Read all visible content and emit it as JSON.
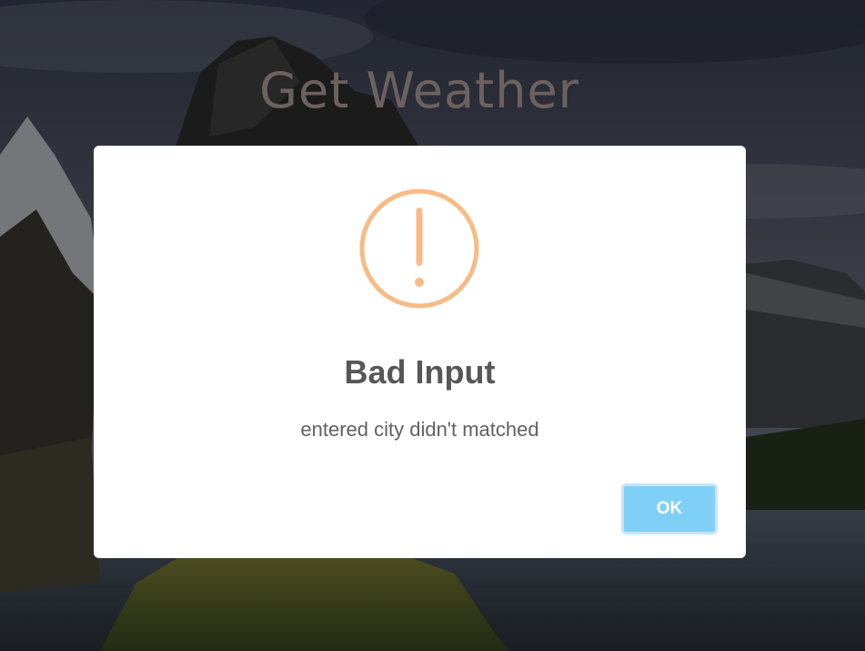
{
  "app": {
    "title": "Get Weather"
  },
  "alert": {
    "icon": "warning-icon",
    "icon_color": "#f8bb86",
    "title": "Bad Input",
    "message": "entered city didn't matched",
    "ok_label": "OK",
    "ok_color": "#7fd0f6"
  }
}
